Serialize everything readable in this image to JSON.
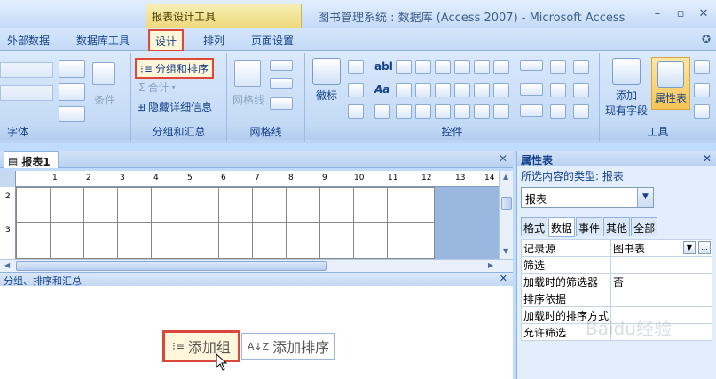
{
  "titlebar": {
    "context_tab_title": "报表设计工具",
    "app_title": "图书管理系统 : 数据库 (Access 2007) - Microsoft Access",
    "minimize": "–",
    "restore": "▫",
    "close": "✕"
  },
  "tabs": [
    {
      "label": "外部数据"
    },
    {
      "label": "数据库工具"
    },
    {
      "label": "设计",
      "active": true
    },
    {
      "label": "排列"
    },
    {
      "label": "页面设置"
    }
  ],
  "help_icon": "✪",
  "ribbon": {
    "groups": {
      "font": "字体",
      "grouping": "分组和汇总",
      "gridlines": "网格线",
      "controls": "控件",
      "tools": "工具"
    },
    "buttons": {
      "conditional": "条件",
      "group_sort": "分组和排序",
      "totals": "合计",
      "hide_details": "隐藏详细信息",
      "gridlines": "网格线",
      "logo": "徽标",
      "add_fields_line1": "添加",
      "add_fields_line2": "现有字段",
      "property_sheet": "属性表",
      "label_abl": "abl",
      "label_aa": "Aa"
    }
  },
  "document": {
    "tab_label": "报表1",
    "close": "✕",
    "ruler_numbers": [
      "1",
      "2",
      "3",
      "4",
      "5",
      "6",
      "7",
      "8",
      "9",
      "10",
      "11",
      "12",
      "13",
      "14"
    ],
    "vruler_numbers": [
      "2",
      "3"
    ]
  },
  "group_sort_panel": {
    "title": "分组、排序和汇总",
    "close": "✕",
    "add_group": "添加组",
    "add_sort": "添加排序"
  },
  "property_sheet": {
    "title": "属性表",
    "close": "✕",
    "selection_type_label": "所选内容的类型: 报表",
    "selected_object": "报表",
    "tabs": [
      {
        "label": "格式"
      },
      {
        "label": "数据",
        "active": true
      },
      {
        "label": "事件"
      },
      {
        "label": "其他"
      },
      {
        "label": "全部"
      }
    ],
    "rows": [
      {
        "key": "记录源",
        "value": "图书表"
      },
      {
        "key": "筛选",
        "value": ""
      },
      {
        "key": "加载时的筛选器",
        "value": "否"
      },
      {
        "key": "排序依据",
        "value": ""
      },
      {
        "key": "加载时的排序方式",
        "value": ""
      },
      {
        "key": "允许筛选",
        "value": ""
      }
    ]
  },
  "watermark": "Baidu经验",
  "colors": {
    "highlight_border": "#e0473a",
    "ribbon_bg": "#c6dcf7",
    "text": "#15428b"
  }
}
